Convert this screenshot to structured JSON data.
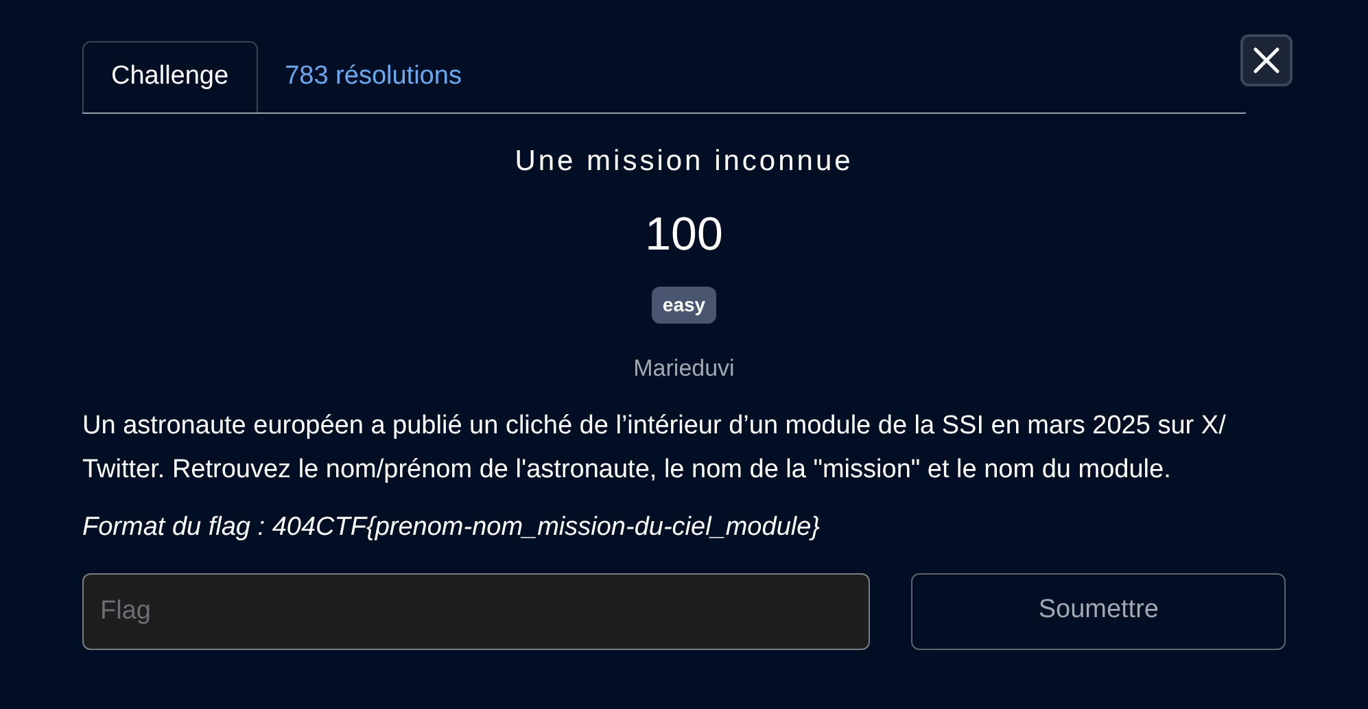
{
  "tabs": [
    {
      "label": "Challenge",
      "selected": true
    },
    {
      "label": "783 résolutions",
      "selected": false
    }
  ],
  "challenge": {
    "title": "Une mission inconnue",
    "points": "100",
    "difficulty": "easy",
    "author": "Marieduvi",
    "description": "Un astronaute européen a publié un cliché de l’intérieur d’un module de la SSI en mars 2025 sur X/ Twitter. Retrouvez le nom/prénom de l'astronaute, le nom de la \"mission\" et le nom du module.",
    "format": "Format du flag : 404CTF{prenom-nom_mission-du-ciel_module}"
  },
  "flag_input": {
    "placeholder": "Flag"
  },
  "submit_button": "Soumettre"
}
